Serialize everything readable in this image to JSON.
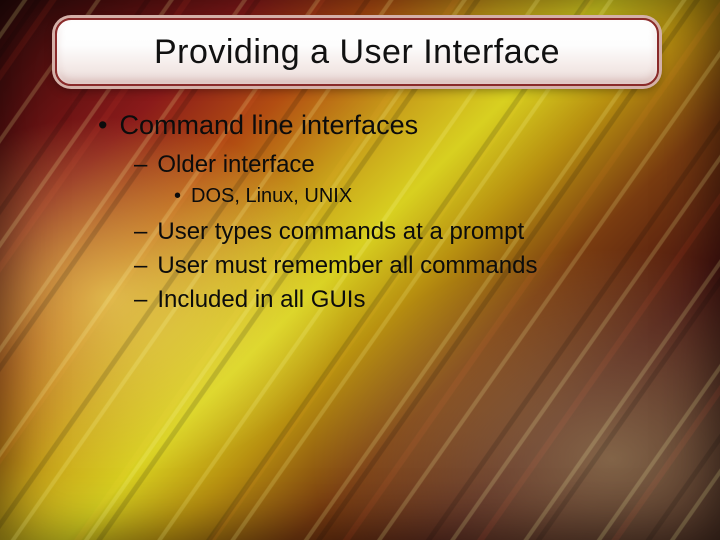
{
  "title": "Providing a User Interface",
  "bullets": {
    "lvl1": {
      "bullet": "•",
      "text": "Command line interfaces"
    },
    "lvl2a": {
      "bullet": "–",
      "text": "Older interface"
    },
    "lvl3a": {
      "bullet": "•",
      "text": "DOS, Linux, UNIX"
    },
    "lvl2b": {
      "bullet": "–",
      "text": "User types commands at a prompt"
    },
    "lvl2c": {
      "bullet": "–",
      "text": "User must remember all commands"
    },
    "lvl2d": {
      "bullet": "–",
      "text": "Included in all GUIs"
    }
  }
}
